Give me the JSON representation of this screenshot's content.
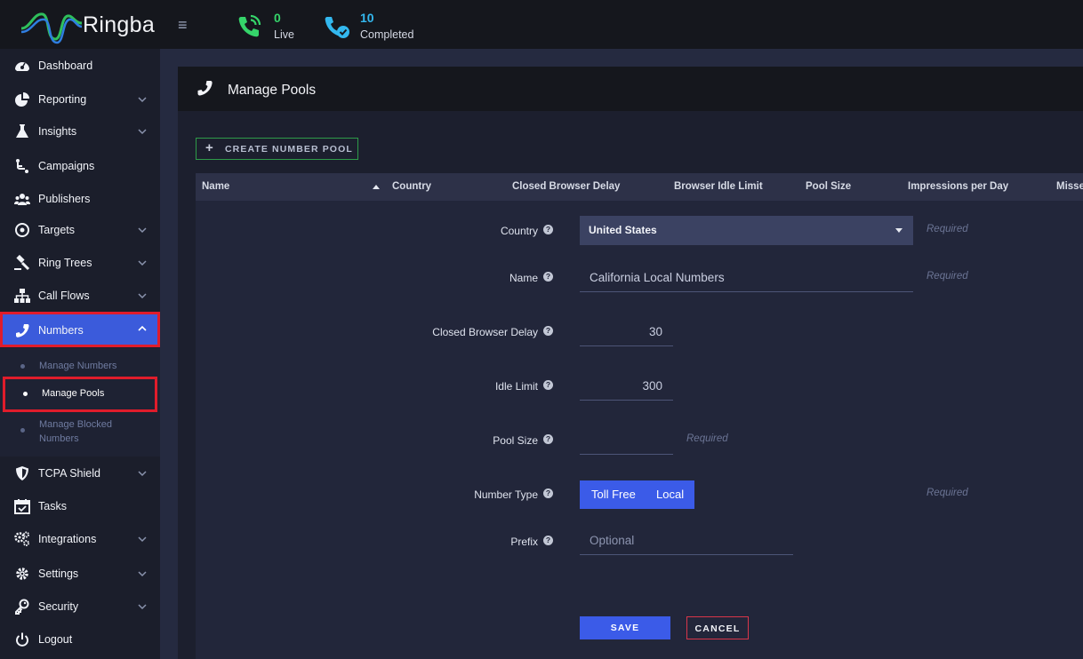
{
  "app": {
    "name": "Ringba"
  },
  "stats": {
    "live": {
      "count": "0",
      "label": "Live"
    },
    "completed": {
      "count": "10",
      "label": "Completed"
    }
  },
  "sidebar": {
    "items": [
      {
        "label": "Dashboard",
        "icon": "dashboard-icon"
      },
      {
        "label": "Reporting",
        "icon": "pie-chart-icon"
      },
      {
        "label": "Insights",
        "icon": "flask-icon"
      },
      {
        "label": "Campaigns",
        "icon": "campaign-icon"
      },
      {
        "label": "Publishers",
        "icon": "users-icon"
      },
      {
        "label": "Targets",
        "icon": "target-icon"
      },
      {
        "label": "Ring Trees",
        "icon": "gavel-icon"
      },
      {
        "label": "Call Flows",
        "icon": "sitemap-icon"
      },
      {
        "label": "Numbers",
        "icon": "phone-icon"
      },
      {
        "label": "TCPA Shield",
        "icon": "shield-icon"
      },
      {
        "label": "Tasks",
        "icon": "calendar-check-icon"
      },
      {
        "label": "Integrations",
        "icon": "cogs-icon"
      },
      {
        "label": "Settings",
        "icon": "gear-icon"
      },
      {
        "label": "Security",
        "icon": "key-icon"
      },
      {
        "label": "Logout",
        "icon": "power-icon"
      }
    ],
    "numbers_sub": [
      {
        "label": "Manage Numbers"
      },
      {
        "label": "Manage Pools"
      },
      {
        "label": "Manage Blocked Numbers"
      }
    ]
  },
  "page": {
    "title": "Manage Pools",
    "create_button": "CREATE NUMBER POOL"
  },
  "table": {
    "columns": [
      "Name",
      "Country",
      "Closed Browser Delay",
      "Browser Idle Limit",
      "Pool Size",
      "Impressions per Day",
      "Misse"
    ]
  },
  "form": {
    "country": {
      "label": "Country",
      "value": "United States",
      "required": "Required"
    },
    "name": {
      "label": "Name",
      "value": "California Local Numbers",
      "required": "Required"
    },
    "closed_browser_delay": {
      "label": "Closed Browser Delay",
      "value": "30"
    },
    "idle_limit": {
      "label": "Idle Limit",
      "value": "300"
    },
    "pool_size": {
      "label": "Pool Size",
      "value": "",
      "required": "Required"
    },
    "number_type": {
      "label": "Number Type",
      "options": [
        "Toll Free",
        "Local"
      ],
      "required": "Required"
    },
    "prefix": {
      "label": "Prefix",
      "placeholder": "Optional"
    },
    "save": "SAVE",
    "cancel": "CANCEL"
  },
  "colors": {
    "accent": "#3b5be8",
    "highlight_border": "#e01c2b",
    "live": "#35d46a",
    "completed": "#33b8ef"
  }
}
